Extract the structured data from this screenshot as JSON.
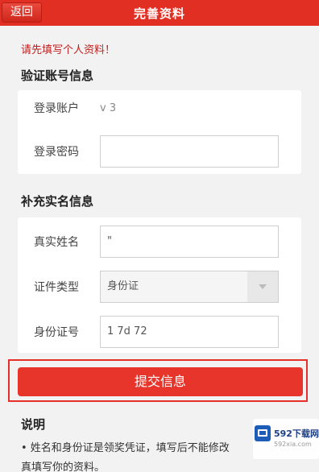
{
  "header": {
    "back_label": "返回",
    "title": "完善资料"
  },
  "notice": "请先填写个人资料！",
  "account_section": {
    "title": "验证账号信息",
    "login_account_label": "登录账户",
    "login_account_value": "v          3",
    "login_password_label": "登录密码",
    "login_password_value": ""
  },
  "identity_section": {
    "title": "补充实名信息",
    "real_name_label": "真实姓名",
    "real_name_value": "  \"",
    "id_type_label": "证件类型",
    "id_type_value": "身份证",
    "id_number_label": "身份证号",
    "id_number_value": "1      7d            72"
  },
  "submit_label": "提交信息",
  "explanation": {
    "title": "说明",
    "line1": "• 姓名和身份证是领奖凭证，填写后不能修改",
    "line2": "真填写你的资料。"
  },
  "watermark": {
    "brand": "592下载网",
    "domain": "592xia.com",
    "accent": "#1c5db8"
  },
  "colors": {
    "header_bg": "#e22f23",
    "notice": "#c21f1f",
    "button": "#e8352b"
  }
}
